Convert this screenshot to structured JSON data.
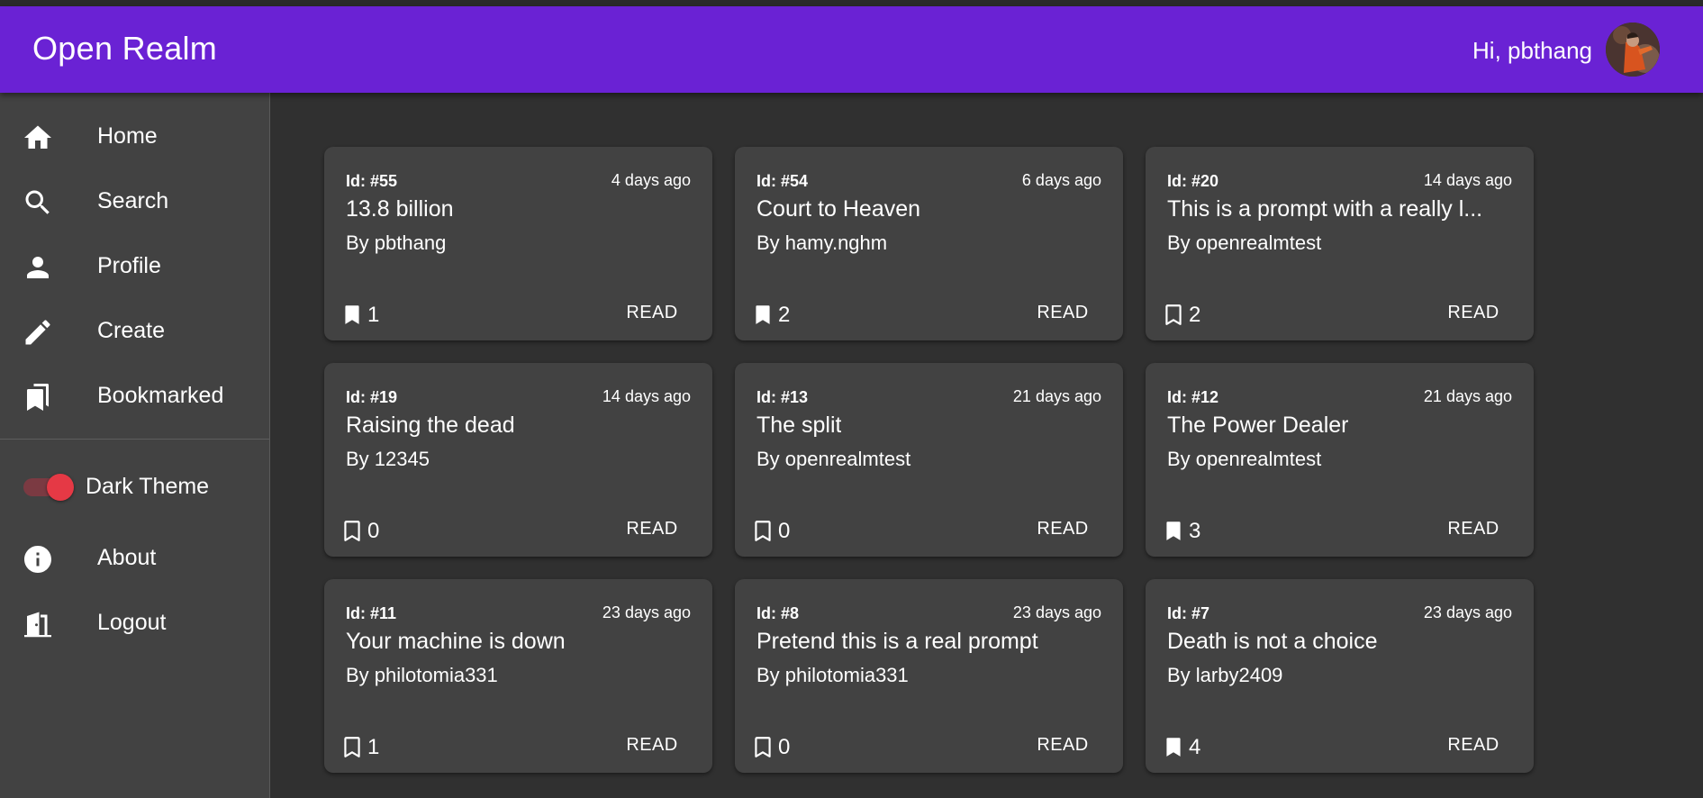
{
  "app": {
    "title": "Open Realm",
    "greeting": "Hi, pbthang"
  },
  "colors": {
    "appbar": "#6a22d4",
    "background": "#303030",
    "surface": "#424242",
    "toggle_accent": "#e53945"
  },
  "sidebar": {
    "items": [
      {
        "label": "Home",
        "icon": "home-icon"
      },
      {
        "label": "Search",
        "icon": "search-icon"
      },
      {
        "label": "Profile",
        "icon": "person-icon"
      },
      {
        "label": "Create",
        "icon": "pencil-icon"
      },
      {
        "label": "Bookmarked",
        "icon": "bookmarks-icon"
      }
    ],
    "theme_toggle": {
      "label": "Dark Theme",
      "on": true
    },
    "bottom_items": [
      {
        "label": "About",
        "icon": "info-icon"
      },
      {
        "label": "Logout",
        "icon": "door-exit-icon"
      }
    ]
  },
  "prompts": [
    {
      "id": "Id: #55",
      "date": "4 days ago",
      "title": "13.8 billion",
      "author": "By pbthang",
      "bookmarks": "1",
      "bookmarked": true,
      "action": "READ"
    },
    {
      "id": "Id: #54",
      "date": "6 days ago",
      "title": "Court to Heaven",
      "author": "By hamy.nghm",
      "bookmarks": "2",
      "bookmarked": true,
      "action": "READ"
    },
    {
      "id": "Id: #20",
      "date": "14 days ago",
      "title": "This is a prompt with a really l...",
      "author": "By openrealmtest",
      "bookmarks": "2",
      "bookmarked": false,
      "action": "READ"
    },
    {
      "id": "Id: #19",
      "date": "14 days ago",
      "title": "Raising the dead",
      "author": "By 12345",
      "bookmarks": "0",
      "bookmarked": false,
      "action": "READ"
    },
    {
      "id": "Id: #13",
      "date": "21 days ago",
      "title": "The split",
      "author": "By openrealmtest",
      "bookmarks": "0",
      "bookmarked": false,
      "action": "READ"
    },
    {
      "id": "Id: #12",
      "date": "21 days ago",
      "title": "The Power Dealer",
      "author": "By openrealmtest",
      "bookmarks": "3",
      "bookmarked": true,
      "action": "READ"
    },
    {
      "id": "Id: #11",
      "date": "23 days ago",
      "title": "Your machine is down",
      "author": "By philotomia331",
      "bookmarks": "1",
      "bookmarked": false,
      "action": "READ"
    },
    {
      "id": "Id: #8",
      "date": "23 days ago",
      "title": "Pretend this is a real prompt",
      "author": "By philotomia331",
      "bookmarks": "0",
      "bookmarked": false,
      "action": "READ"
    },
    {
      "id": "Id: #7",
      "date": "23 days ago",
      "title": "Death is not a choice",
      "author": "By larby2409",
      "bookmarks": "4",
      "bookmarked": true,
      "action": "READ"
    }
  ]
}
